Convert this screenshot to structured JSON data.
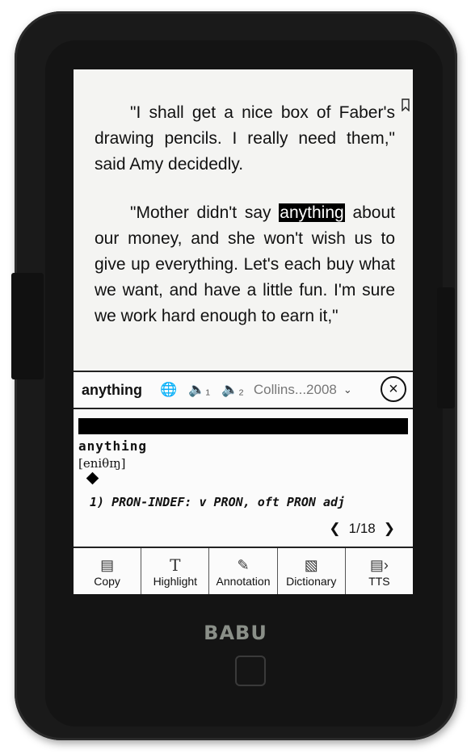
{
  "reader": {
    "paragraph1": "\"I shall get a nice box of Faber's drawing pencils. I really need them,\" said Amy decidedly.",
    "paragraph2_before": "\"Mother didn't say ",
    "selected_word": "anything",
    "paragraph2_after": " about our money, and she won't wish us to give up everything. Let's each buy what we want, and have a little fun. I'm sure we work hard enough to earn it,\""
  },
  "dictionary": {
    "lookup_word": "anything",
    "source": "Collins...2008",
    "headword": "anything",
    "pronunciation": "[eniθɪŋ]",
    "definition": "1) PRON-INDEF: v  PRON, oft PRON adj",
    "page": "1/18"
  },
  "toolbar": [
    {
      "label": "Copy",
      "icon": "copy-icon"
    },
    {
      "label": "Highlight",
      "icon": "highlight-icon"
    },
    {
      "label": "Annotation",
      "icon": "annotation-icon"
    },
    {
      "label": "Dictionary",
      "icon": "dictionary-icon"
    },
    {
      "label": "TTS",
      "icon": "tts-icon"
    }
  ],
  "device": {
    "brand": "BABU"
  }
}
